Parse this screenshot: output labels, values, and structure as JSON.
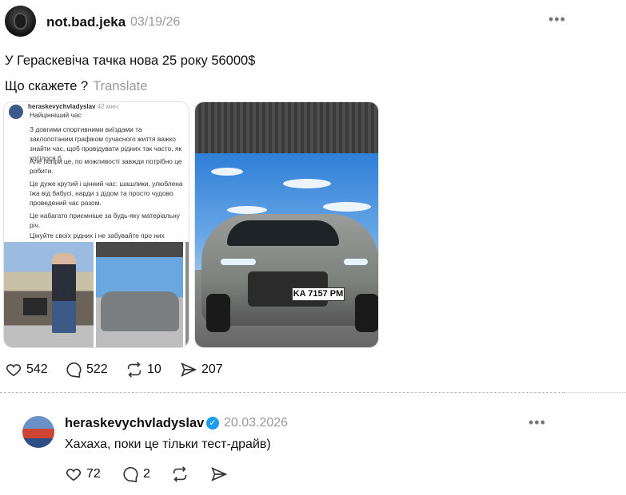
{
  "post": {
    "username": "not.bad.jeka",
    "date": "03/19/26",
    "more": "•••",
    "line1": "У Гераскевіча тачка нова 25 року 56000$",
    "line2": "Що скажете ?",
    "translate": "Translate",
    "screenshot": {
      "username": "heraskevychvladyslav",
      "time": "42 мин.",
      "t1": "Найцінніший час",
      "t2": "З довгими спортивними виїздами та заклопотаним графіком сучасного життя важко знайти час, щоб провідувати рідних так часто, як хотілося б.",
      "t3": "Але попри це, по можливості завжди потрібно це робити.",
      "t4": "Це дуже крутий і цінний час: шашлики, улюблена їжа від бабусі, нарди з дідом та просто чудово проведений час разом.",
      "t5": "Це набагато приємніше за будь-яку матеріальну річ.",
      "t6": "Цінуйте своїх рідних і не забувайте про них"
    },
    "plate": "KA 7157 PM",
    "likes": "542",
    "comments": "522",
    "reposts": "10",
    "shares": "207"
  },
  "comment": {
    "username": "heraskevychvladyslav",
    "verified": "✓",
    "date": "20.03.2026",
    "more": "•••",
    "text": "Хахаха, поки це тільки тест-драйв)",
    "likes": "72",
    "comments": "2"
  },
  "colors": {
    "verified": "#1d9bf0",
    "muted": "#999999"
  }
}
